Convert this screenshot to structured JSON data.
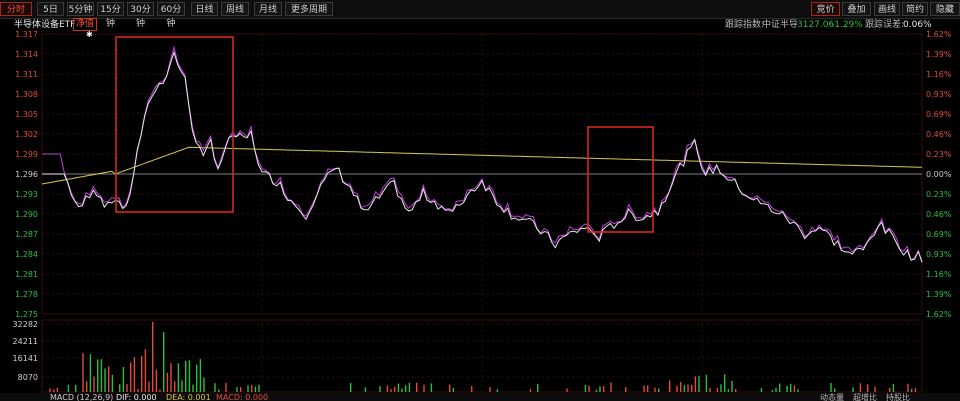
{
  "toolbar": {
    "left": [
      "分时",
      "5日",
      "5分钟",
      "15分钟",
      "30分钟",
      "60分钟",
      "日线",
      "周线",
      "月线",
      "更多周期"
    ],
    "right": [
      "竞价",
      "叠加",
      "画线",
      "简约",
      "隐藏"
    ]
  },
  "info": {
    "name": "半导体设备ETF",
    "badge": "净值",
    "track_label": "跟踪指数:",
    "index_name": "中证半导",
    "index_value": "3127.06",
    "index_change": "-1.29%",
    "error_label": "跟踪误差:",
    "error_value": "0.06%"
  },
  "axis": {
    "price_ticks": [
      "1.317",
      "1.314",
      "1.311",
      "1.308",
      "1.305",
      "1.302",
      "1.299",
      "1.296",
      "1.293",
      "1.290",
      "1.287",
      "1.284",
      "1.281",
      "1.278",
      "1.275"
    ],
    "pct_ticks": [
      "1.62%",
      "1.39%",
      "1.16%",
      "0.93%",
      "0.69%",
      "0.46%",
      "0.23%",
      "0.00%",
      "0.23%",
      "0.46%",
      "0.69%",
      "0.93%",
      "1.16%",
      "1.39%",
      "1.62%"
    ],
    "volume_ticks": [
      "32282",
      "24211",
      "16141",
      "8070"
    ]
  },
  "bottom": {
    "macd_title": "MACD (12,26,9)",
    "dif": "DIF: 0.000",
    "dea": "DEA: 0.001",
    "macd": "MACD: 0.000",
    "tabs": [
      "动态量",
      "超增比",
      "持股比"
    ]
  },
  "colors": {
    "price": "#e8e8e8",
    "index": "#c040d8",
    "avg": "#d8c848",
    "up": "#e24a3a",
    "down": "#28c23a",
    "highlight": "#e02a20"
  },
  "chart_data": {
    "type": "line",
    "ylim": [
      1.275,
      1.317
    ],
    "x_minutes": 240,
    "series": [],
    "volume_ylim": [
      0,
      32282
    ],
    "macd": {
      "dif": 0.0,
      "dea": 0.001,
      "macd": 0.0
    }
  }
}
